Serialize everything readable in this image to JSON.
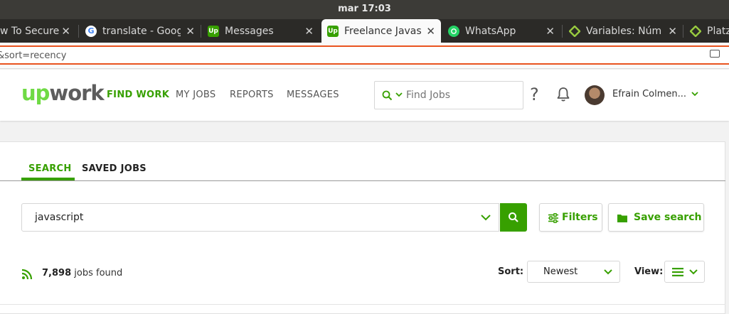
{
  "os": {
    "clock": "mar 17:03"
  },
  "browser": {
    "tabs": [
      {
        "title": "w To Secure",
        "favicon": "none",
        "active": false
      },
      {
        "title": "translate - Goog",
        "favicon": "google-icon",
        "active": false
      },
      {
        "title": "Messages",
        "favicon": "upwork-icon",
        "active": false
      },
      {
        "title": "Freelance Javas",
        "favicon": "upwork-icon",
        "active": true
      },
      {
        "title": "WhatsApp",
        "favicon": "whatsapp-icon",
        "active": false
      },
      {
        "title": "Variables: Núm",
        "favicon": "platzi-icon",
        "active": false
      },
      {
        "title": "Platz",
        "favicon": "platzi-icon",
        "active": false
      }
    ],
    "url": "&sort=recency"
  },
  "header": {
    "logo": {
      "up": "up",
      "work": "work"
    },
    "nav": [
      "FIND WORK",
      "MY JOBS",
      "REPORTS",
      "MESSAGES"
    ],
    "search": {
      "placeholder": "Find Jobs"
    },
    "help": "?",
    "user_name": "Efrain Colmen..."
  },
  "main": {
    "tabs": [
      "SEARCH",
      "SAVED JOBS"
    ],
    "query": "javascript",
    "filters_label": "Filters",
    "save_search_label": "Save search",
    "jobs_count": "7,898",
    "jobs_found_label": "jobs found",
    "sort_label": "Sort:",
    "sort_value": "Newest",
    "view_label": "View:"
  },
  "colors": {
    "accent": "#37a000",
    "logo_green": "#6fda44",
    "url_focus": "#e95420"
  }
}
